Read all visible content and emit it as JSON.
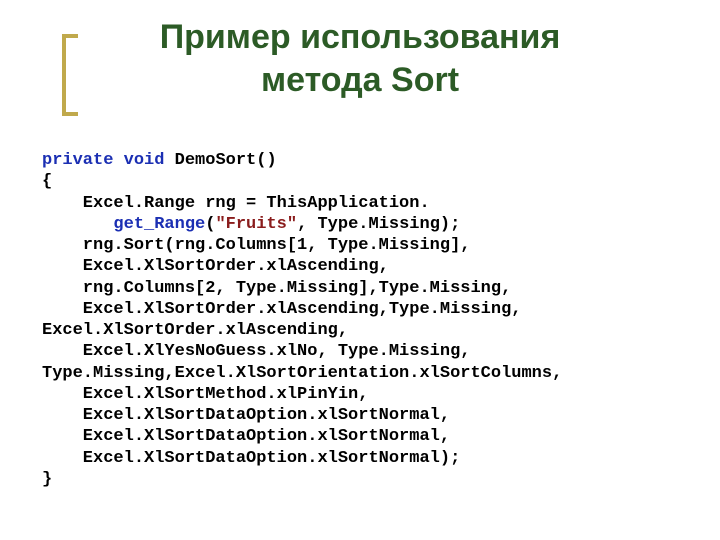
{
  "slide": {
    "title_line1": "Пример использования",
    "title_line2": "метода Sort"
  },
  "code": {
    "l01_kw1": "private",
    "l01_kw2": "void",
    "l01_rest": " DemoSort()",
    "l02": "{",
    "l03_a": "    Excel.Range rng = ThisApplication.",
    "l04_ind": "       ",
    "l04_m": "get_Range",
    "l04_p1": "(",
    "l04_str": "\"Fruits\"",
    "l04_p2": ", Type.Missing);",
    "l05": "    rng.Sort(rng.Columns[1, Type.Missing],",
    "l06": "    Excel.XlSortOrder.xlAscending,",
    "l07": "    rng.Columns[2, Type.Missing],Type.Missing,",
    "l08": "    Excel.XlSortOrder.xlAscending,Type.Missing,",
    "l09": "Excel.XlSortOrder.xlAscending,",
    "l10": "    Excel.XlYesNoGuess.xlNo, Type.Missing,",
    "l11": "Type.Missing,Excel.XlSortOrientation.xlSortColumns,",
    "l12": "    Excel.XlSortMethod.xlPinYin,",
    "l13": "    Excel.XlSortDataOption.xlSortNormal,",
    "l14": "    Excel.XlSortDataOption.xlSortNormal,",
    "l15": "    Excel.XlSortDataOption.xlSortNormal);",
    "l16": "}"
  }
}
